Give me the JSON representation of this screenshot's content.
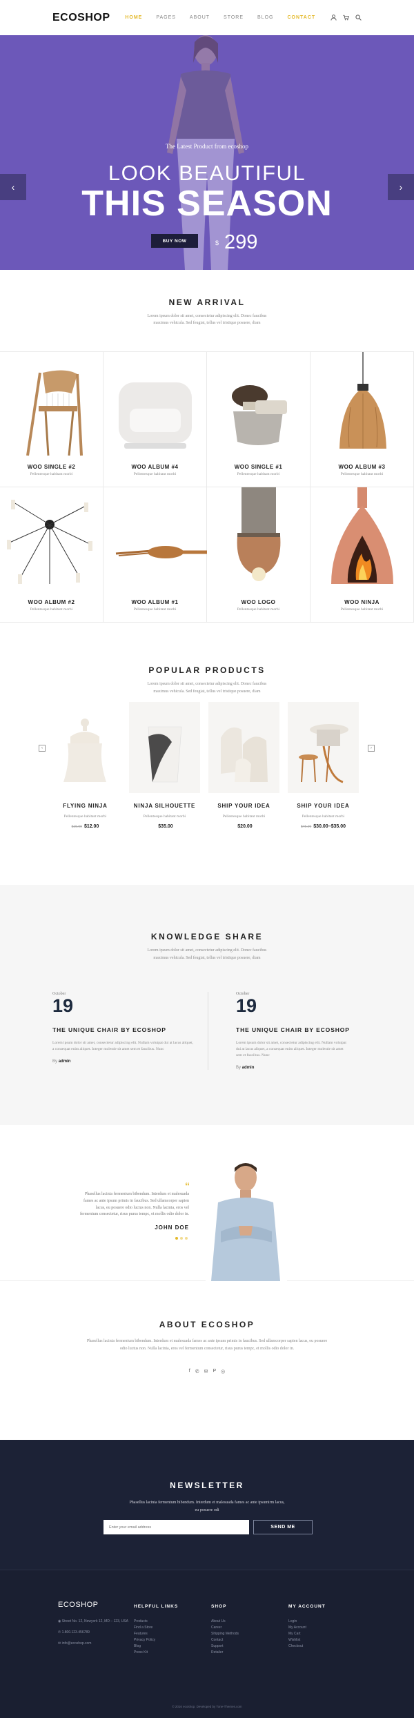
{
  "header": {
    "logo": "ECOSHOP",
    "nav": [
      "HOME",
      "PAGES",
      "ABOUT",
      "STORE",
      "BLOG",
      "CONTACT"
    ],
    "icons": [
      "user-icon",
      "cart-icon",
      "search-icon"
    ]
  },
  "hero": {
    "pretitle": "The Latest Product from ecoshop",
    "line1": "LOOK BEAUTIFUL",
    "line2": "THIS SEASON",
    "button": "BUY NOW",
    "currency": "$",
    "price": "299",
    "prev": "‹",
    "next": "›"
  },
  "arrival": {
    "title": "NEW ARRIVAL",
    "desc": "Lorem ipsum dolor sit amet, consectetur adipiscing elit. Donec faucibus maximus vehicula. Sed feugiat, tellus vel tristique posuere, diam",
    "items": [
      {
        "name": "WOO SINGLE #2",
        "sub": "Pellentesque habitant morbi"
      },
      {
        "name": "WOO ALBUM #4",
        "sub": "Pellentesque habitant morbi"
      },
      {
        "name": "WOO SINGLE #1",
        "sub": "Pellentesque habitant morbi"
      },
      {
        "name": "WOO ALBUM #3",
        "sub": "Pellentesque habitant morbi"
      },
      {
        "name": "WOO ALBUM #2",
        "sub": "Pellentesque habitant morbi"
      },
      {
        "name": "WOO ALBUM #1",
        "sub": "Pellentesque habitant morbi"
      },
      {
        "name": "WOO LOGO",
        "sub": "Pellentesque habitant morbi"
      },
      {
        "name": "WOO NINJA",
        "sub": "Pellentesque habitant morbi"
      }
    ]
  },
  "popular": {
    "title": "POPULAR PRODUCTS",
    "desc": "Lorem ipsum dolor sit amet, consectetur adipiscing elit. Donec faucibus maximus vehicula. Sed feugiat, tellus vel tristique posuere, diam",
    "prev": "‹",
    "next": "›",
    "items": [
      {
        "name": "FLYING NINJA",
        "sub": "Pellentesque habitant morbi",
        "old": "$15.00",
        "price": "$12.00"
      },
      {
        "name": "NINJA SILHOUETTE",
        "sub": "Pellentesque habitant morbi",
        "old": "",
        "price": "$35.00"
      },
      {
        "name": "SHIP YOUR IDEA",
        "sub": "Pellentesque habitant morbi",
        "old": "",
        "price": "$20.00"
      },
      {
        "name": "SHIP YOUR IDEA",
        "sub": "Pellentesque habitant morbi",
        "old": "$45.00",
        "price": "$30.00–$35.00"
      }
    ]
  },
  "knowledge": {
    "title": "KNOWLEDGE SHARE",
    "desc": "Lorem ipsum dolor sit amet, consectetur adipiscing elit. Donec faucibus maximus vehicula. Sed feugiat, tellus vel tristique posuere, diam",
    "posts": [
      {
        "month": "October",
        "day": "19",
        "title": "THE UNIQUE CHAIR BY ECOSHOP",
        "excerpt": "Lorem ipsum dolor sit amet, consectetur adipiscing elit. Nullam volutpat dui at lacus aliquet, a consequat enim aliquet. Integer molestie sit amet sem et faucibus. Nunc",
        "by": "By",
        "author": "admin"
      },
      {
        "month": "October",
        "day": "19",
        "title": "THE UNIQUE CHAIR BY ECOSHOP",
        "excerpt": "Lorem ipsum dolor sit amet, consectetur adipiscing elit. Nullam volutpat dui at lacus aliquet, a consequat enim aliquet. Integer molestie sit amet sem et faucibus. Nunc",
        "by": "By",
        "author": "admin"
      }
    ]
  },
  "testimonial": {
    "quote_mark": "“",
    "text": "Phasellus lacinia fermentum bibendum. Interdum et malesuada fames ac ante ipsum primis in faucibus. Sed ullamcorper sapien lacus, eu posuere odio luctus non. Nulla lacinia, eros vel fermentum consectetur, risus purus tempc, et mollis odio dolor in.",
    "name": "JOHN DOE"
  },
  "about": {
    "title": "ABOUT ECOSHOP",
    "desc": "Phasellus lacinia fermentum bibendum. Interdum et malesuada fames ac ante ipsum primis in faucibus. Sed ullamcorper sapien lacus, eu posuere odio luctus non. Nulla lacinia, eros vel fermentum consectetur, risus purus tempc, et mollis odio dolor in.",
    "social": [
      "f",
      "✆",
      "✉",
      "P",
      "◎"
    ]
  },
  "newsletter": {
    "title": "NEWSLETTER",
    "desc": "Phasellus lacinia fermentum bibendum. Interdum et malesuada fames ac ante ipsumirm lacus, eu posuere odi",
    "placeholder": "Enter your email address",
    "button": "SEND ME"
  },
  "footer": {
    "logo": "ECOSHOP",
    "address": "Street No. 12, Newyork 12, MD – 123, USA",
    "phone": "1.800.123.456789",
    "email": "info@ecoshop.com",
    "columns": [
      {
        "title": "HELPFUL LINKS",
        "links": [
          "Products",
          "Find a Store",
          "Features",
          "Privacy Policy",
          "Blog",
          "Press Kit"
        ]
      },
      {
        "title": "SHOP",
        "links": [
          "About Us",
          "Career",
          "Shipping Methods",
          "Contact",
          "Support",
          "Retailer"
        ]
      },
      {
        "title": "MY ACCOUNT",
        "links": [
          "Login",
          "My Account",
          "My Cart",
          "Wishlist",
          "Checkout"
        ]
      }
    ],
    "copyright": "© 2016 ecoshop. Developed by Tone-Themes.com"
  }
}
